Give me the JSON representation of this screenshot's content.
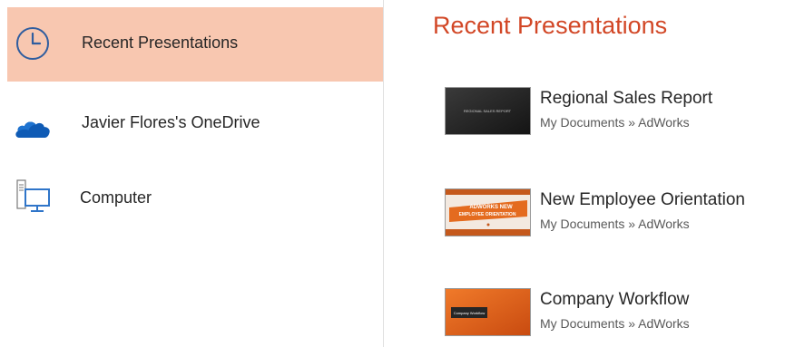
{
  "places": {
    "recent": {
      "label": "Recent Presentations",
      "icon": "clock-icon",
      "selected": true
    },
    "onedrive": {
      "label": "Javier Flores's OneDrive",
      "icon": "onedrive-cloud-icon"
    },
    "computer": {
      "label": "Computer",
      "icon": "computer-icon"
    }
  },
  "main": {
    "heading": "Recent Presentations",
    "files": [
      {
        "name": "Regional Sales Report",
        "path": "My Documents » AdWorks",
        "thumb_text": "REGIONAL SALES REPORT"
      },
      {
        "name": "New Employee Orientation",
        "path": "My Documents » AdWorks",
        "thumb_text_1": "ADWORKS NEW",
        "thumb_text_2": "EMPLOYEE ORIENTATION"
      },
      {
        "name": "Company Workflow",
        "path": "My Documents » AdWorks",
        "thumb_text": "Company Workflow"
      }
    ]
  },
  "colors": {
    "accent": "#d24726",
    "selected_bg": "#f8c7b0",
    "onedrive_blue": "#0f5bb5"
  }
}
